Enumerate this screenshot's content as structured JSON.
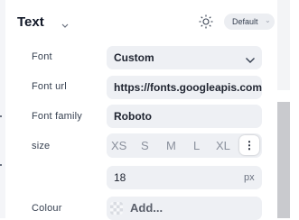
{
  "section": {
    "title": "Text",
    "preset_label": "Default"
  },
  "rows": {
    "font": {
      "label": "Font",
      "value": "Custom"
    },
    "font_url": {
      "label": "Font url",
      "value": "https://fonts.googleapis.com"
    },
    "font_family": {
      "label": "Font family",
      "value": "Roboto"
    },
    "size": {
      "label": "size",
      "options": [
        "XS",
        "S",
        "M",
        "L",
        "XL"
      ],
      "more_glyph": "⋮",
      "value": "18",
      "unit": "px"
    },
    "colour": {
      "label": "Colour",
      "value": "Add..."
    }
  },
  "icons": [
    "chevron-down-icon",
    "sun-icon",
    "more-vertical-icon",
    "transparent-swatch-icon"
  ]
}
